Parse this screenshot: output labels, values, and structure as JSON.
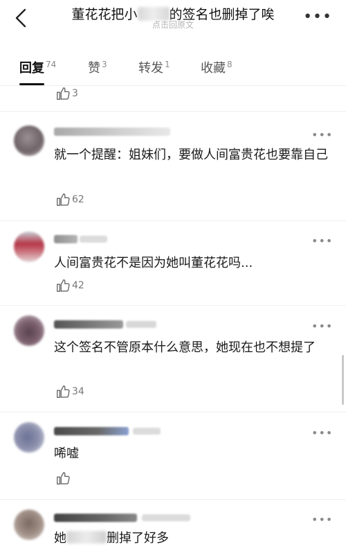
{
  "header": {
    "title_prefix": "董花花把小",
    "title_suffix": "的签名也删掉了唉",
    "subtitle": "点击回原文",
    "more": "•••"
  },
  "tabs": [
    {
      "label": "回复",
      "count": "74"
    },
    {
      "label": "赞",
      "count": "3"
    },
    {
      "label": "转发",
      "count": "1"
    },
    {
      "label": "收藏",
      "count": "8"
    }
  ],
  "top_partial": {
    "likes": "3"
  },
  "comments": [
    {
      "text": "就一个提醒：姐妹们，要做人间富贵花也要靠自己",
      "likes": "62",
      "more": "•••"
    },
    {
      "text": "人间富贵花不是因为她叫董花花吗...",
      "likes": "42",
      "more": "•••"
    },
    {
      "text": "这个签名不管原本什么意思，她现在也不想提了",
      "likes": "34",
      "more": "•••"
    },
    {
      "text": "唏嘘",
      "likes": "",
      "more": "•••"
    },
    {
      "text_prefix": "她",
      "text_suffix": "删掉了好多",
      "likes": "",
      "more": "•••"
    }
  ],
  "colors": {
    "accent": "#111111",
    "muted": "#777777",
    "divider": "#efefef"
  }
}
